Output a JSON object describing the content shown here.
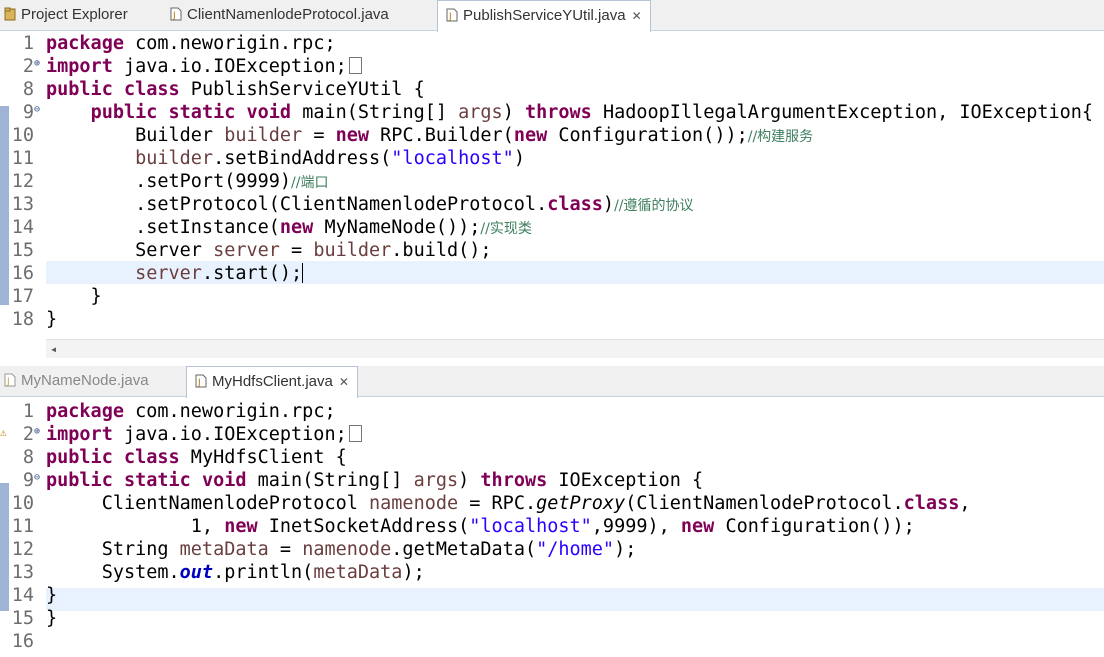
{
  "top_tabs": [
    {
      "label": "Project Explorer",
      "icon": "project-explorer-icon"
    },
    {
      "label": "ClientNamenlodeProtocol.java",
      "icon": "java-file-icon"
    },
    {
      "label": "PublishServiceYUtil.java",
      "icon": "java-file-icon",
      "active": true
    }
  ],
  "bottom_tabs": [
    {
      "label": "MyNameNode.java",
      "icon": "java-file-icon"
    },
    {
      "label": "MyHdfsClient.java",
      "icon": "java-file-icon",
      "active": true
    }
  ],
  "top_editor": {
    "line_numbers": [
      "1",
      "2",
      "8",
      "9",
      "10",
      "11",
      "12",
      "13",
      "14",
      "15",
      "16",
      "17",
      "18"
    ],
    "lines": [
      "package com.neworigin.rpc;",
      "import java.io.IOException;",
      "public class PublishServiceYUtil {",
      "    public static void main(String[] args) throws HadoopIllegalArgumentException, IOException{",
      "        Builder builder = new RPC.Builder(new Configuration());//构建服务",
      "        builder.setBindAddress(\"localhost\")",
      "        .setPort(9999)//端口",
      "        .setProtocol(ClientNamenlodeProtocol.class)//遵循的协议",
      "        .setInstance(new MyNameNode());//实现类",
      "        Server server = builder.build();",
      "        server.start();",
      "    }",
      "}"
    ]
  },
  "bottom_editor": {
    "line_numbers": [
      "1",
      "2",
      "8",
      "9",
      "10",
      "11",
      "12",
      "13",
      "14",
      "15",
      "16"
    ],
    "lines": [
      "package com.neworigin.rpc;",
      "import java.io.IOException;",
      "public class MyHdfsClient {",
      "public static void main(String[] args) throws IOException {",
      "     ClientNamenlodeProtocol namenode = RPC.getProxy(ClientNamenlodeProtocol.class,",
      "             1, new InetSocketAddress(\"localhost\",9999), new Configuration());",
      "     String metaData = namenode.getMetaData(\"/home\");",
      "     System.out.println(metaData);",
      "}",
      "}",
      ""
    ]
  },
  "colors": {
    "keyword": "#7f0055",
    "string": "#2a00ff",
    "comment": "#3f7f5f",
    "current_line": "#e8f2fe"
  }
}
